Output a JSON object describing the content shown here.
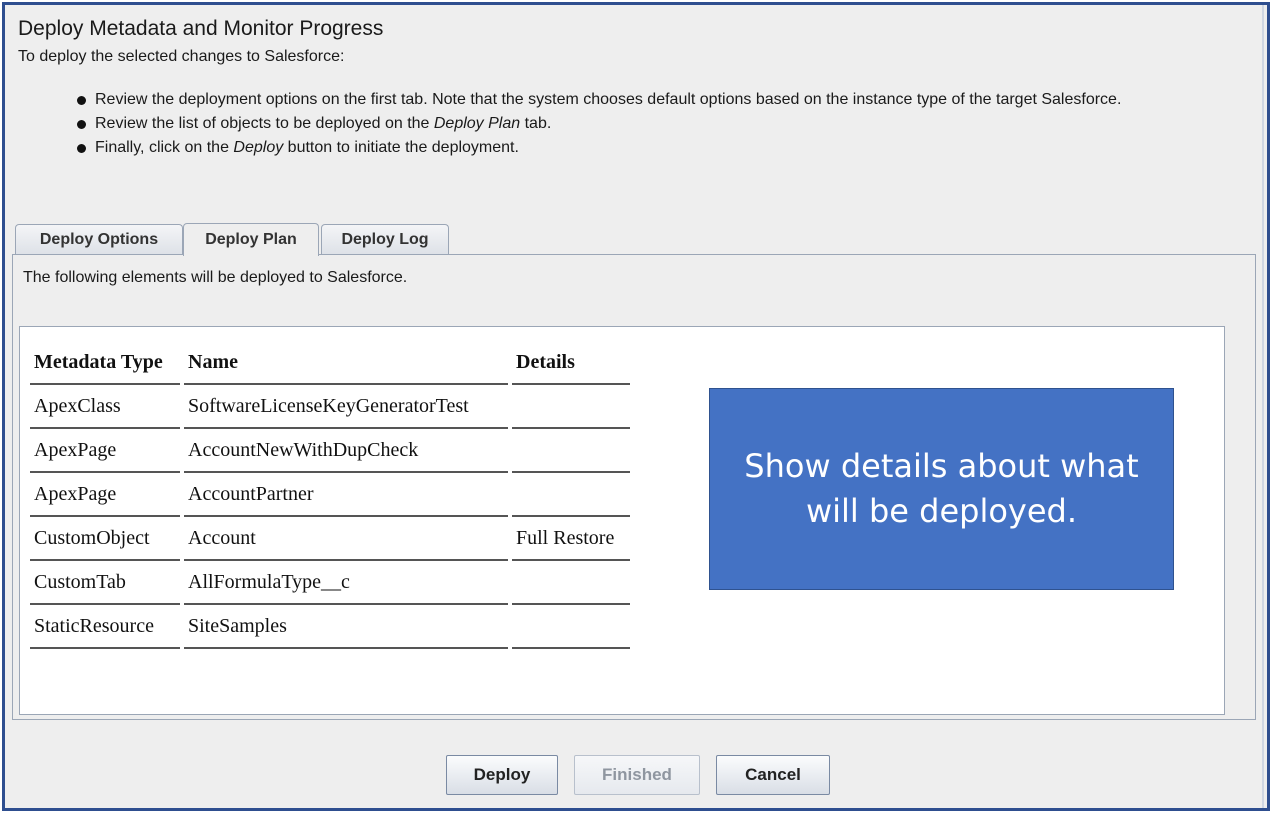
{
  "header": {
    "title": "Deploy Metadata and Monitor Progress",
    "subtitle": "To deploy the selected changes to Salesforce:"
  },
  "instructions": [
    {
      "before": "Review the deployment options on the first tab. Note that the system chooses default options based on the instance type of the target Salesforce.",
      "em": "",
      "after": ""
    },
    {
      "before": "Review the list of objects to be deployed on the ",
      "em": "Deploy Plan",
      "after": " tab."
    },
    {
      "before": "Finally, click on the ",
      "em": "Deploy",
      "after": " button to initiate the deployment."
    }
  ],
  "tabs": [
    {
      "label": "Deploy Options",
      "active": false
    },
    {
      "label": "Deploy Plan",
      "active": true
    },
    {
      "label": "Deploy Log",
      "active": false
    }
  ],
  "panel": {
    "description": "The following elements will be deployed to Salesforce."
  },
  "table": {
    "headers": {
      "type": "Metadata Type",
      "name": "Name",
      "details": "Details"
    },
    "rows": [
      {
        "type": "ApexClass",
        "name": "SoftwareLicenseKeyGeneratorTest",
        "details": ""
      },
      {
        "type": "ApexPage",
        "name": "AccountNewWithDupCheck",
        "details": ""
      },
      {
        "type": "ApexPage",
        "name": "AccountPartner",
        "details": ""
      },
      {
        "type": "CustomObject",
        "name": "Account",
        "details": "Full Restore"
      },
      {
        "type": "CustomTab",
        "name": "AllFormulaType__c",
        "details": ""
      },
      {
        "type": "StaticResource",
        "name": "SiteSamples",
        "details": ""
      }
    ]
  },
  "callout": {
    "text": "Show details about what will be deployed."
  },
  "buttons": {
    "deploy": "Deploy",
    "finished": "Finished",
    "cancel": "Cancel"
  },
  "colors": {
    "callout_fill": "#4472c4",
    "frame_border": "#2e4e8f",
    "panel_bg": "#eeeeee"
  }
}
